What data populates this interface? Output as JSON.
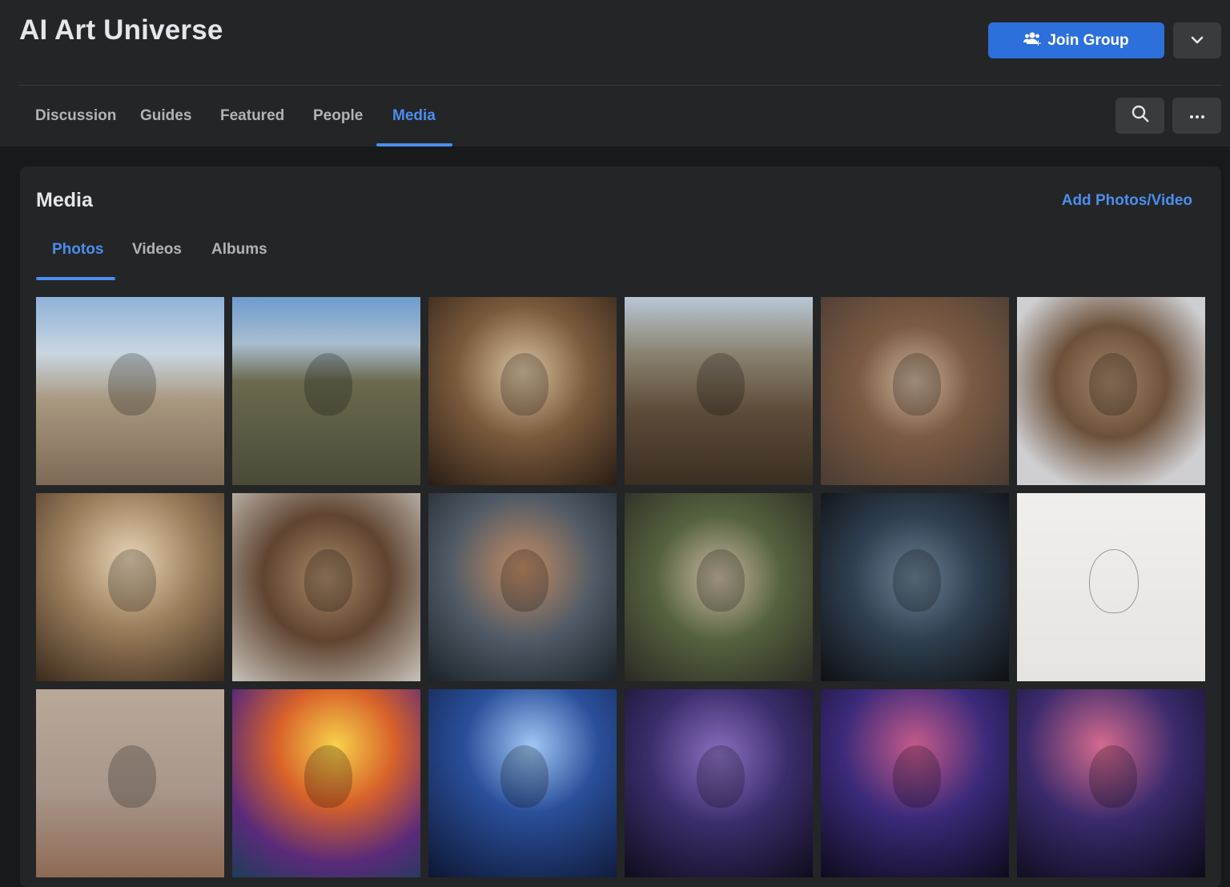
{
  "header": {
    "group_name": "AI Art Universe",
    "join_label": "Join Group"
  },
  "nav": {
    "tabs": [
      "Discussion",
      "Guides",
      "Featured",
      "People",
      "Media"
    ],
    "active": "Media"
  },
  "media": {
    "title": "Media",
    "add_label": "Add Photos/Video",
    "subtabs": [
      "Photos",
      "Videos",
      "Albums"
    ],
    "active_subtab": "Photos"
  },
  "colors": {
    "accent": "#4b8ef0",
    "button_primary": "#2d6fdb",
    "panel": "#242526",
    "background": "#18191a"
  },
  "photos": [
    {
      "name": "photo-crowd-stadium-walls",
      "bg": "linear-gradient(180deg,#8fb2d9 0%,#c9d6e0 30%,#a89880 55%,#7d6a56 100%)"
    },
    {
      "name": "photo-stadium-faces",
      "bg": "linear-gradient(180deg,#6d9ccf 0%,#a9bdcf 25%,#6b6a4e 45%,#4a4a38 100%)"
    },
    {
      "name": "photo-root-sculpture-workers",
      "bg": "radial-gradient(circle at 50% 40%,#d8c2a0 0%,#7a5a3c 45%,#2a1d14 100%)"
    },
    {
      "name": "photo-root-wasteland",
      "bg": "linear-gradient(180deg,#b9c8d6 0%,#8a8270 30%,#5e4c3a 60%,#3a2e22 100%)"
    },
    {
      "name": "photo-face-tree-street",
      "bg": "radial-gradient(circle at 50% 45%,#c9b199 0%,#7b5b42 40%,#4a3b33 100%)"
    },
    {
      "name": "photo-root-head-plaza",
      "bg": "radial-gradient(circle at 50% 45%,#a48468 0%,#6c513a 40%,#cfcfd2 80%)"
    },
    {
      "name": "photo-throne-of-faces",
      "bg": "radial-gradient(circle at 50% 35%,#e6d2b4 0%,#9b7e5c 45%,#3b2a1c 100%)"
    },
    {
      "name": "photo-face-pile-hall",
      "bg": "radial-gradient(circle at 50% 45%,#a98866 0%,#5f4430 45%,#c8c2ba 100%)"
    },
    {
      "name": "photo-cyborg-portrait",
      "bg": "radial-gradient(circle at 50% 40%,#c28b63 0%,#4f5a66 50%,#1b2228 100%)"
    },
    {
      "name": "photo-moss-head",
      "bg": "radial-gradient(circle at 50% 45%,#c7b7a0 0%,#55623f 45%,#2b2a24 100%)"
    },
    {
      "name": "photo-blue-stone-head",
      "bg": "radial-gradient(circle at 50% 45%,#6a7f92 0%,#2f3f50 45%,#0e0f12 100%)"
    },
    {
      "name": "photo-guitar-sketch",
      "bg": "linear-gradient(180deg,#f0efed 0%,#e6e4e1 100%)"
    },
    {
      "name": "photo-guitarist-desert",
      "bg": "linear-gradient(180deg,#b9a999 0%,#a8968a 55%,#8e6a54 100%)"
    },
    {
      "name": "photo-dancing-forest",
      "bg": "radial-gradient(circle at 55% 30%,#f7d24a 0%,#d8622a 35%,#5a2a7a 70%,#1e3d5a 100%)"
    },
    {
      "name": "photo-child-window-cosmos",
      "bg": "radial-gradient(circle at 55% 30%,#9fc7f5 0%,#2a4f9a 40%,#0d1633 100%)"
    },
    {
      "name": "photo-child-window-creatures",
      "bg": "radial-gradient(circle at 50% 35%,#8a6fc1 0%,#3b2d6b 45%,#0f0c1c 100%)"
    },
    {
      "name": "photo-child-window-nebula",
      "bg": "radial-gradient(circle at 50% 30%,#c45a8a 0%,#3b2a7a 45%,#0e0b1d 100%)"
    },
    {
      "name": "photo-child-window-spider",
      "bg": "radial-gradient(circle at 45% 30%,#d46a8e 0%,#3a2a6c 45%,#0c0a18 100%)"
    }
  ]
}
